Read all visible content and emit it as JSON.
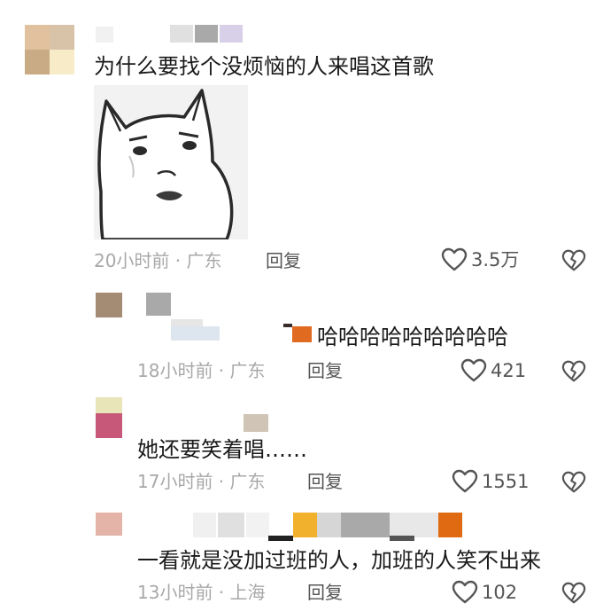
{
  "comments": [
    {
      "text": "为什么要找个没烦恼的人来唱这首歌",
      "meta": "20小时前 · 广东",
      "reply": "回复",
      "likes": "3.5万",
      "sticker": "cat-face-sticker"
    },
    {
      "text": "哈哈哈哈哈哈哈哈哈",
      "meta": "18小时前 · 广东",
      "reply": "回复",
      "likes": "421"
    },
    {
      "text": "她还要笑着唱……",
      "meta": "17小时前 · 广东",
      "reply": "回复",
      "likes": "1551"
    },
    {
      "text": "一看就是没加过班的人，加班的人笑不出来",
      "meta": "13小时前 · 上海",
      "reply": "回复",
      "likes": "102"
    }
  ],
  "icons": {
    "like": "heart-outline-icon",
    "dislike": "broken-heart-icon"
  },
  "colors": {
    "meta": "#a8a8a8",
    "text": "#1a1a1a",
    "icon": "#555555"
  }
}
